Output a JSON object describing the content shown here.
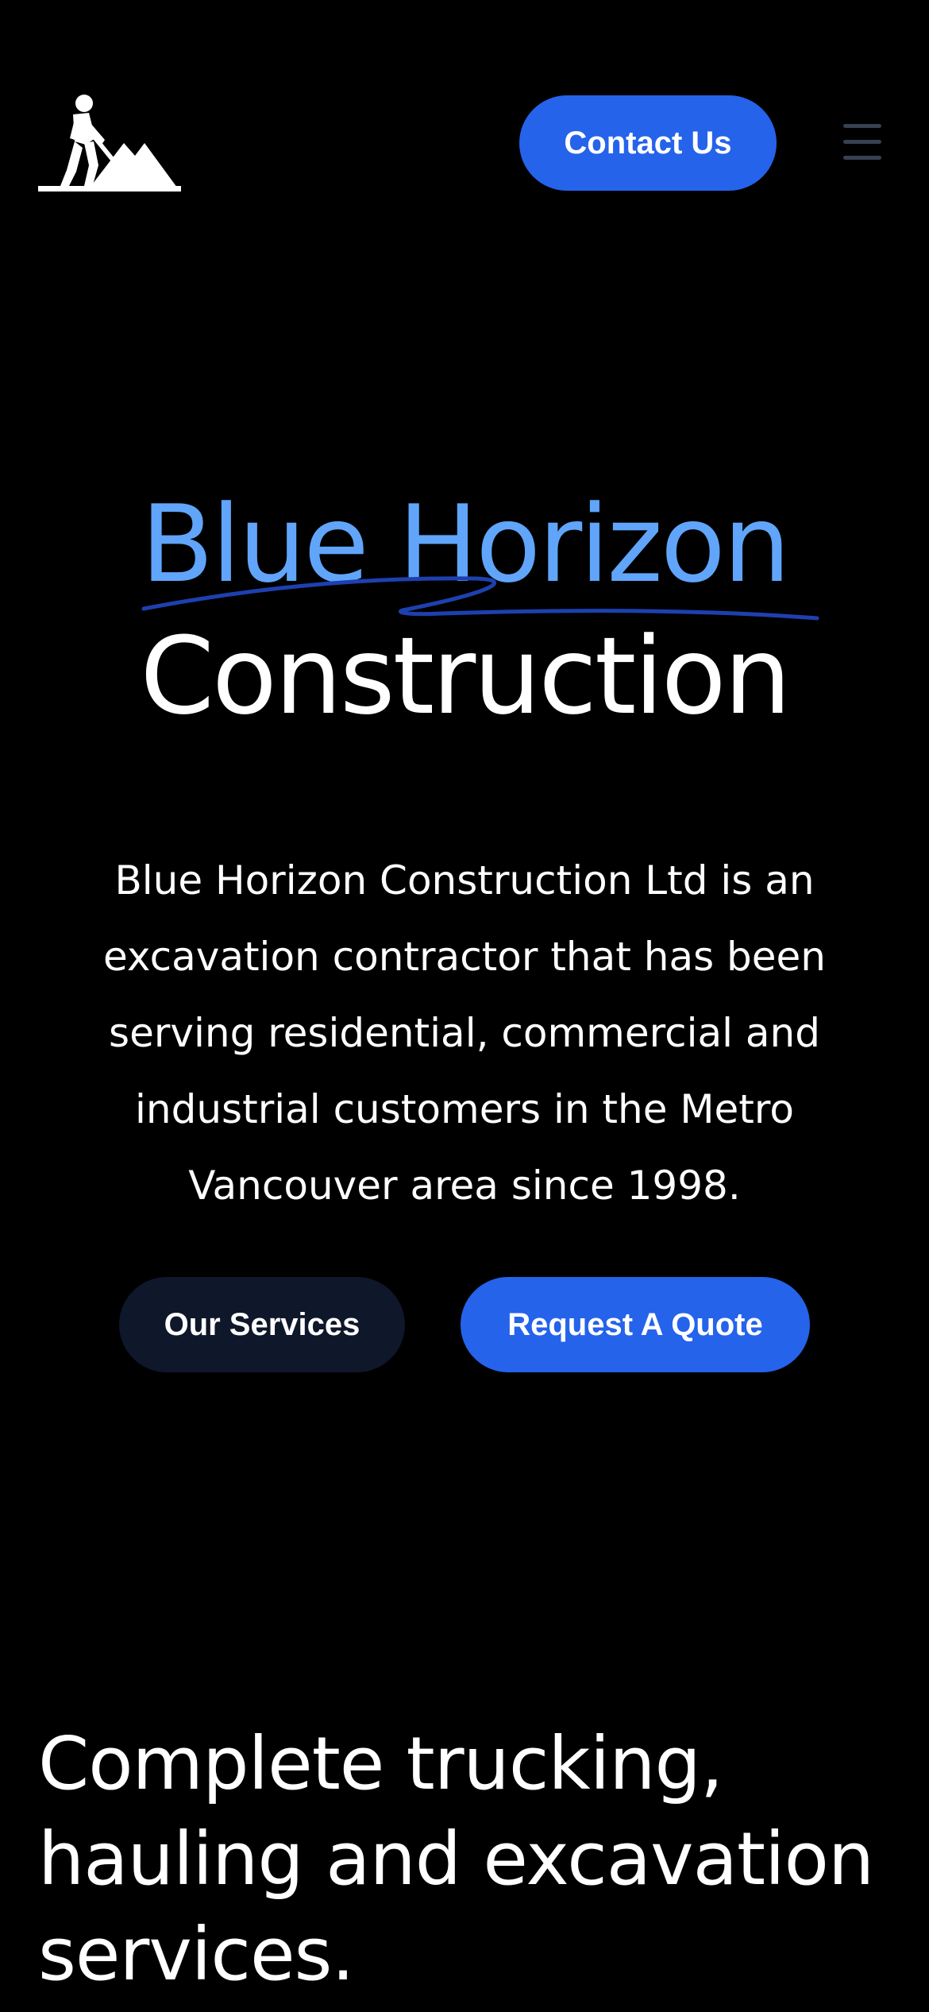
{
  "header": {
    "logo_icon": "worker-digging-icon",
    "contact_label": "Contact Us",
    "menu_icon": "hamburger-menu-icon"
  },
  "hero": {
    "title_line1": "Blue Horizon",
    "title_line2": "Construction",
    "description": "Blue Horizon Construction Ltd is an excavation contractor that has been serving residential, commercial and industrial customers in the Metro Vancouver area since 1998.",
    "services_label": "Our Services",
    "quote_label": "Request A Quote"
  },
  "section": {
    "heading": "Complete trucking, hauling and excavation services."
  },
  "colors": {
    "background": "#000000",
    "accent_blue": "#2563eb",
    "title_blue": "#60a5fa",
    "swoosh_blue": "#1e40af",
    "dark_button": "#0f172a",
    "menu_icon": "#374151"
  }
}
